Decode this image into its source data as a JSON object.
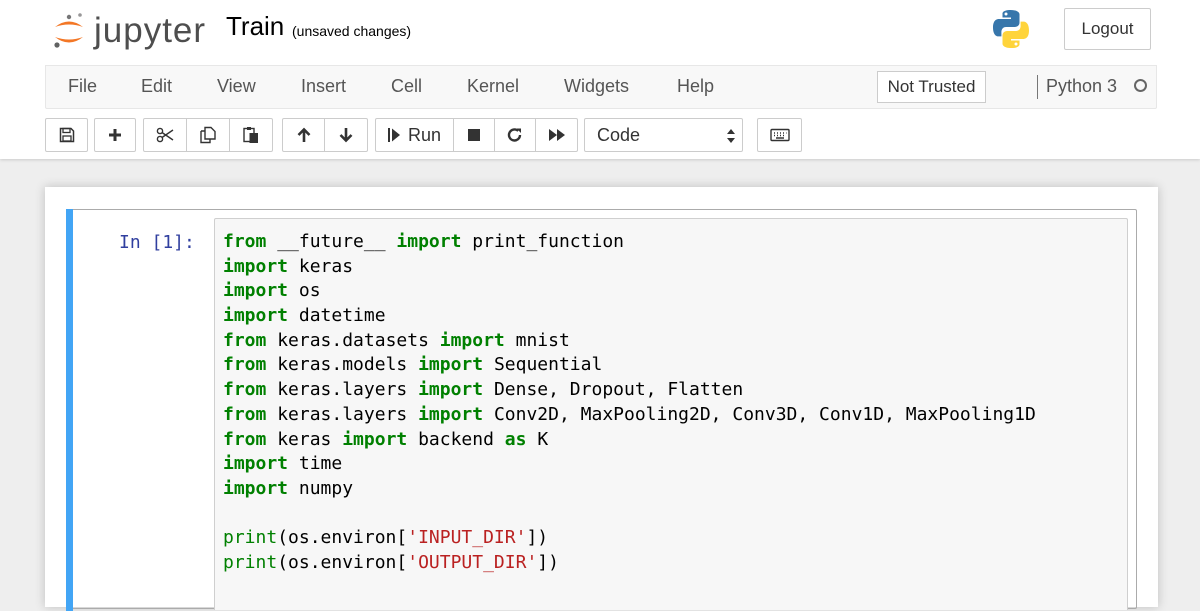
{
  "header": {
    "logo_text": "jupyter",
    "notebook_title": "Train",
    "save_status": "(unsaved changes)",
    "logout_label": "Logout"
  },
  "menubar": {
    "items": [
      "File",
      "Edit",
      "View",
      "Insert",
      "Cell",
      "Kernel",
      "Widgets",
      "Help"
    ],
    "trusted_label": "Not Trusted",
    "kernel_name": "Python 3"
  },
  "toolbar": {
    "run_label": "Run",
    "cell_type": "Code",
    "icons": [
      "save-icon",
      "plus-icon",
      "scissors-icon",
      "copy-icon",
      "paste-icon",
      "arrow-up-icon",
      "arrow-down-icon",
      "step-forward-icon",
      "stop-icon",
      "restart-icon",
      "fast-forward-icon",
      "keyboard-icon"
    ]
  },
  "cell": {
    "prompt": "In [1]:",
    "lines": [
      [
        [
          "kw",
          "from"
        ],
        [
          "nm",
          " __future__ "
        ],
        [
          "kw",
          "import"
        ],
        [
          "nm",
          " print_function"
        ]
      ],
      [
        [
          "kw",
          "import"
        ],
        [
          "nm",
          " keras"
        ]
      ],
      [
        [
          "kw",
          "import"
        ],
        [
          "nm",
          " os"
        ]
      ],
      [
        [
          "kw",
          "import"
        ],
        [
          "nm",
          " datetime"
        ]
      ],
      [
        [
          "kw",
          "from"
        ],
        [
          "nm",
          " keras.datasets "
        ],
        [
          "kw",
          "import"
        ],
        [
          "nm",
          " mnist"
        ]
      ],
      [
        [
          "kw",
          "from"
        ],
        [
          "nm",
          " keras.models "
        ],
        [
          "kw",
          "import"
        ],
        [
          "nm",
          " Sequential"
        ]
      ],
      [
        [
          "kw",
          "from"
        ],
        [
          "nm",
          " keras.layers "
        ],
        [
          "kw",
          "import"
        ],
        [
          "nm",
          " Dense, Dropout, Flatten"
        ]
      ],
      [
        [
          "kw",
          "from"
        ],
        [
          "nm",
          " keras.layers "
        ],
        [
          "kw",
          "import"
        ],
        [
          "nm",
          " Conv2D, MaxPooling2D, Conv3D, Conv1D, MaxPooling1D"
        ]
      ],
      [
        [
          "kw",
          "from"
        ],
        [
          "nm",
          " keras "
        ],
        [
          "kw",
          "import"
        ],
        [
          "nm",
          " backend "
        ],
        [
          "kw",
          "as"
        ],
        [
          "nm",
          " K"
        ]
      ],
      [
        [
          "kw",
          "import"
        ],
        [
          "nm",
          " time"
        ]
      ],
      [
        [
          "kw",
          "import"
        ],
        [
          "nm",
          " numpy"
        ]
      ],
      [],
      [
        [
          "fn",
          "print"
        ],
        [
          "pn",
          "(os.environ["
        ],
        [
          "st",
          "'INPUT_DIR'"
        ],
        [
          "pn",
          "])"
        ]
      ],
      [
        [
          "fn",
          "print"
        ],
        [
          "pn",
          "(os.environ["
        ],
        [
          "st",
          "'OUTPUT_DIR'"
        ],
        [
          "pn",
          "])"
        ]
      ]
    ]
  },
  "colors": {
    "keyword": "#008000",
    "string": "#ba2121",
    "prompt": "#303f9f",
    "cell_selected_bar": "#42a5f5"
  }
}
